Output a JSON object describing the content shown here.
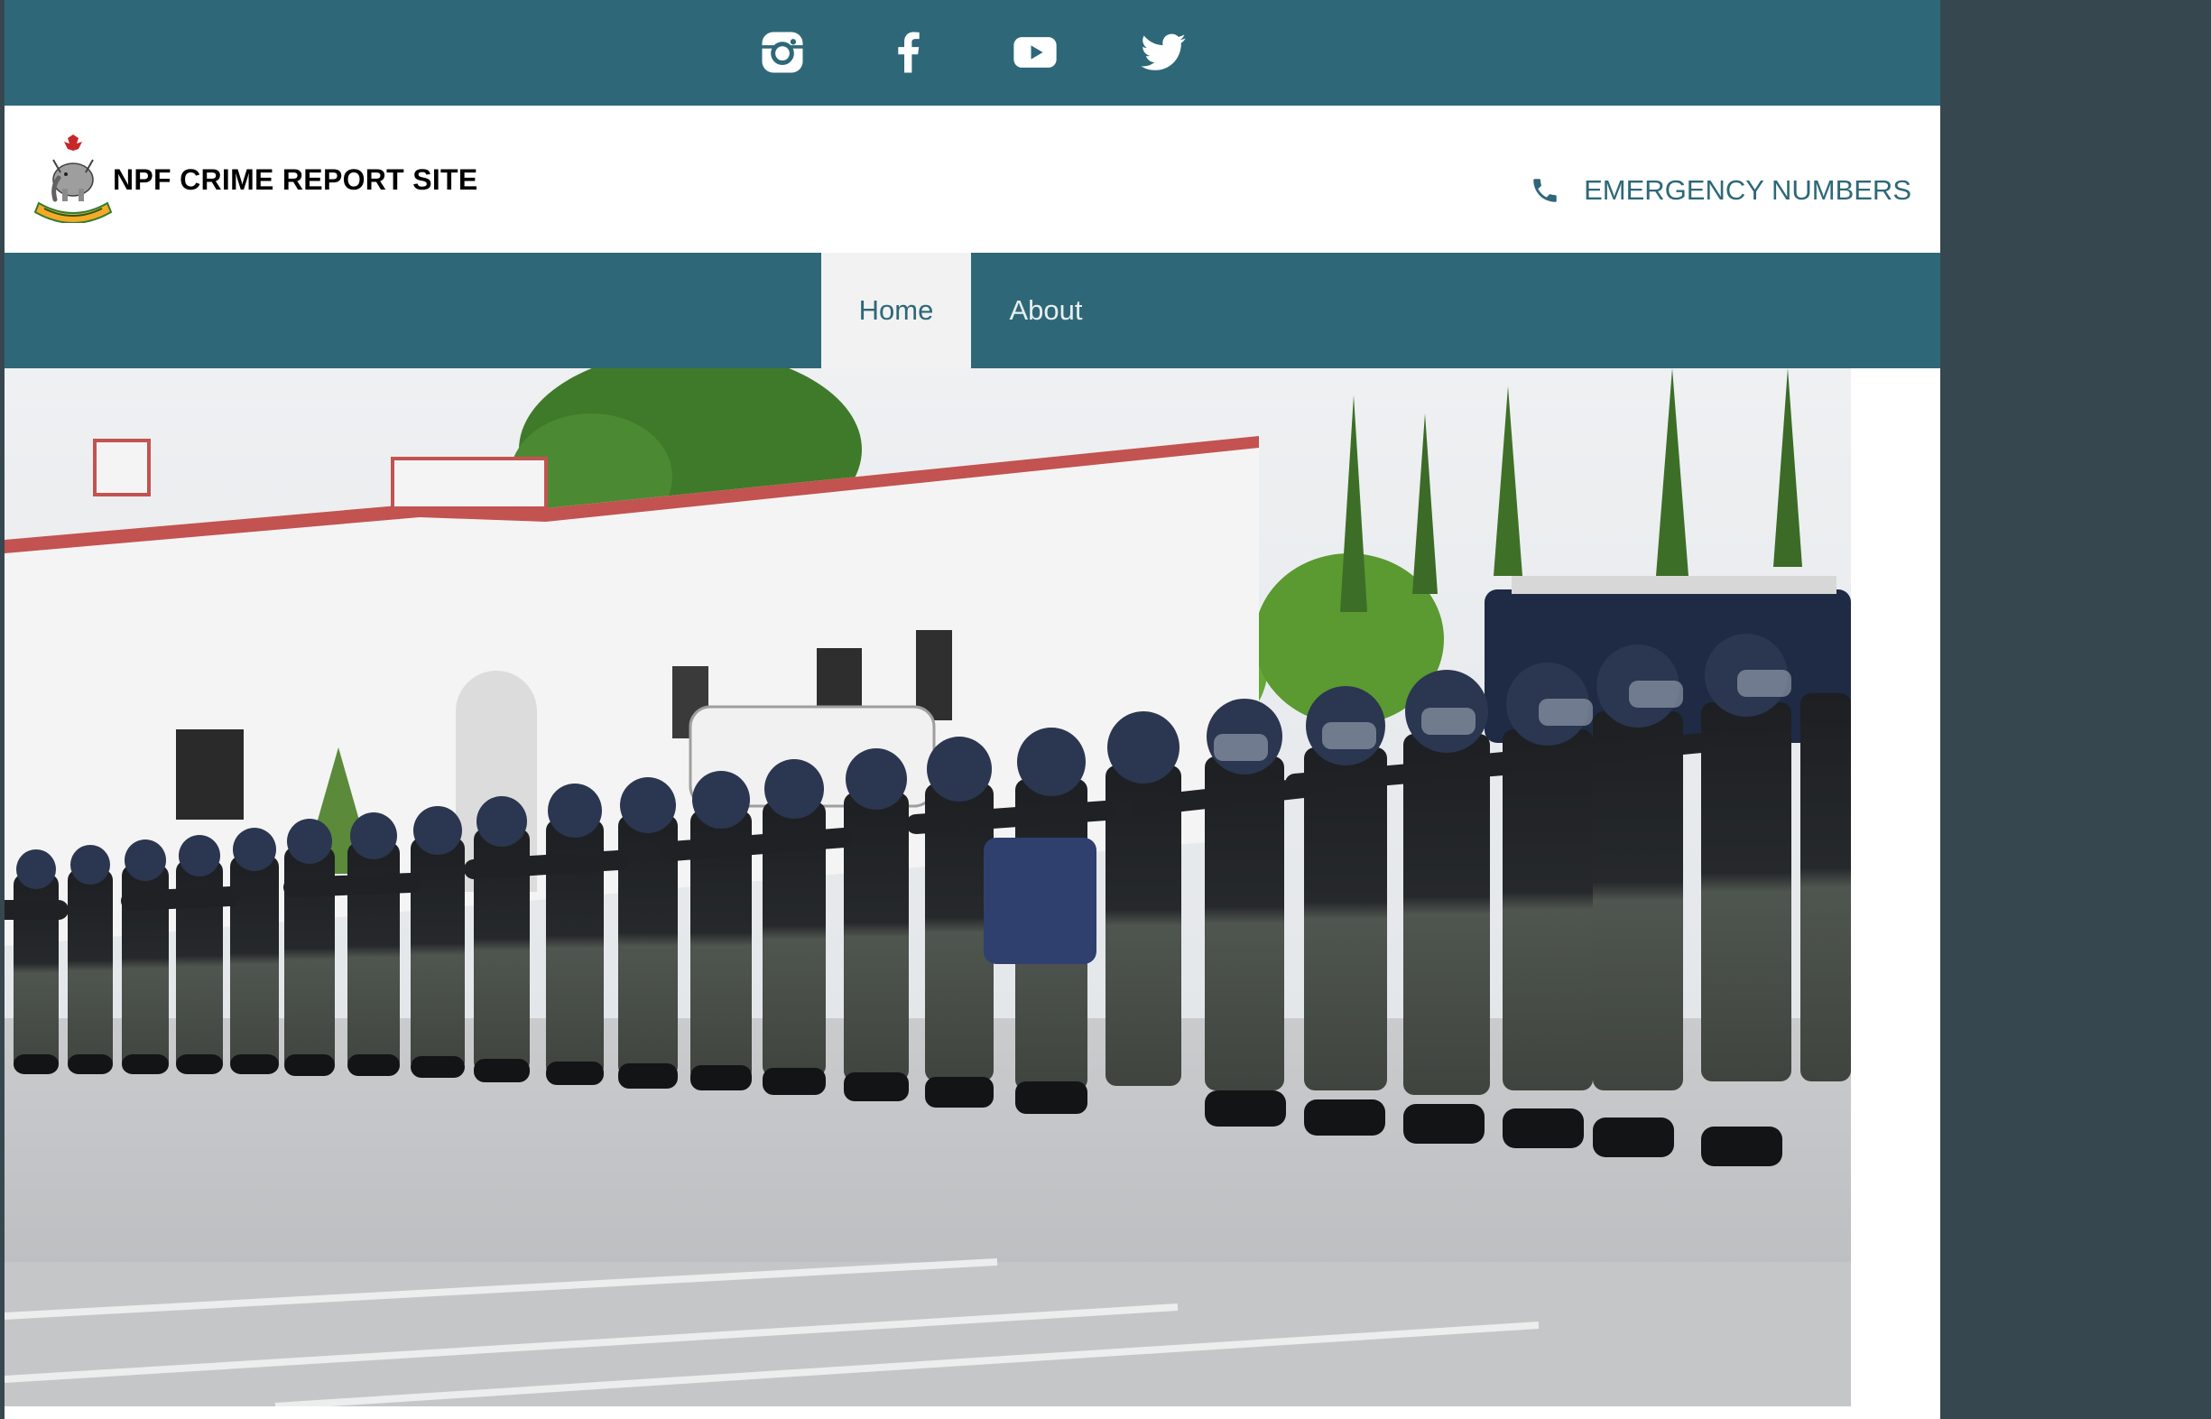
{
  "social": [
    {
      "name": "instagram",
      "icon": "instagram-icon"
    },
    {
      "name": "facebook",
      "icon": "facebook-icon"
    },
    {
      "name": "youtube",
      "icon": "youtube-icon"
    },
    {
      "name": "twitter",
      "icon": "twitter-icon"
    }
  ],
  "header": {
    "title": "NPF CRIME REPORT SITE",
    "logo_icon": "nigeria-police-crest",
    "emergency_label": "EMERGENCY NUMBERS",
    "emergency_icon": "phone-icon"
  },
  "nav": {
    "items": [
      {
        "label": "Home",
        "active": true
      },
      {
        "label": "About",
        "active": false
      }
    ]
  },
  "hero": {
    "description_icon": "hero-photo"
  },
  "colors": {
    "brand": "#2e6878",
    "gutter": "#37474f",
    "nav_active_bg": "#f2f2f2"
  }
}
